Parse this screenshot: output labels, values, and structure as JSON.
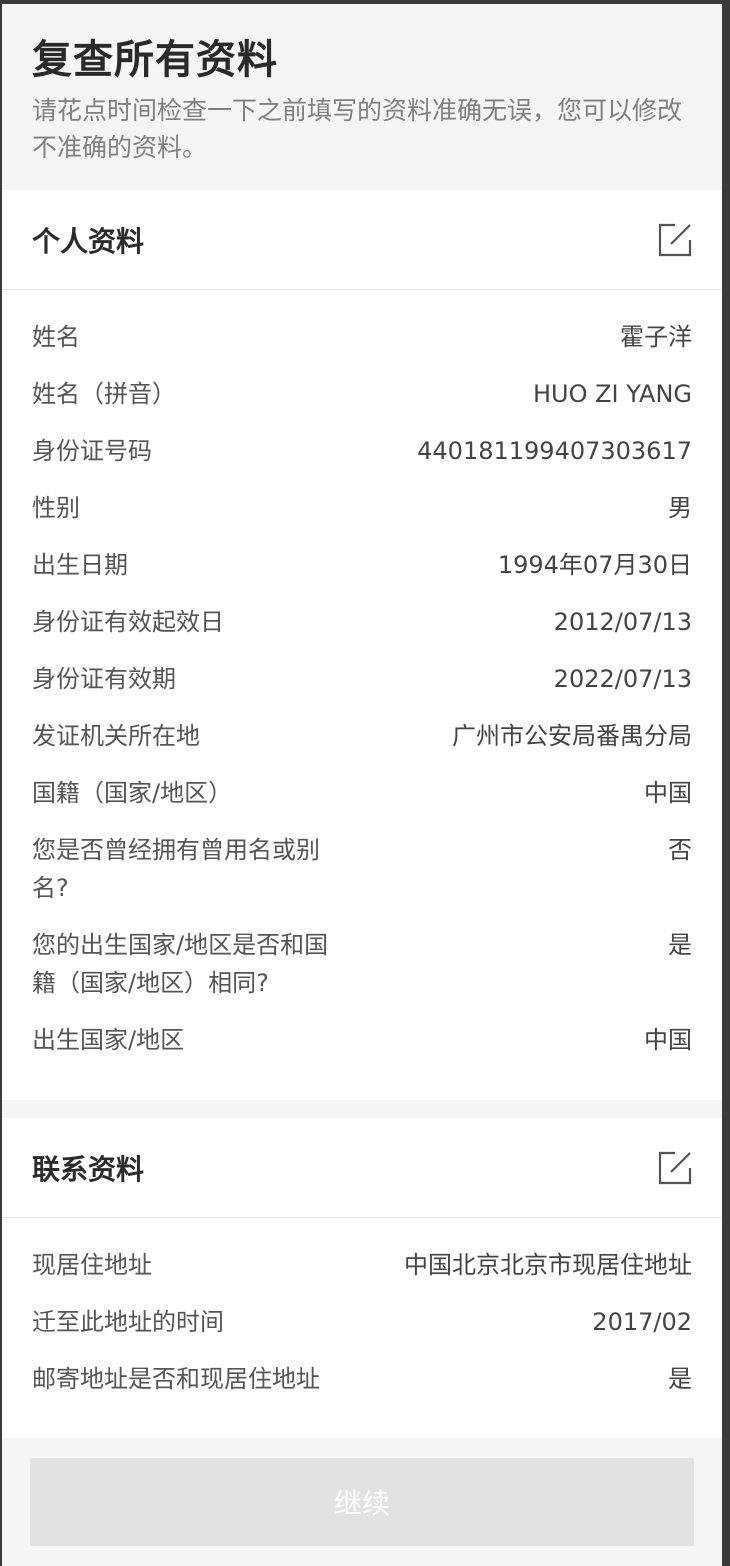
{
  "header": {
    "title": "复查所有资料",
    "subtitle": "请花点时间检查一下之前填写的资料准确无误，您可以修改不准确的资料。"
  },
  "personal": {
    "title": "个人资料",
    "edit_icon": "edit-icon",
    "rows": [
      {
        "label": "姓名",
        "value": "霍子洋"
      },
      {
        "label": "姓名（拼音）",
        "value": "HUO ZI YANG"
      },
      {
        "label": "身份证号码",
        "value": "440181199407303617"
      },
      {
        "label": "性别",
        "value": "男"
      },
      {
        "label": "出生日期",
        "value": "1994年07月30日"
      },
      {
        "label": "身份证有效起效日",
        "value": "2012/07/13"
      },
      {
        "label": "身份证有效期",
        "value": "2022/07/13"
      },
      {
        "label": "发证机关所在地",
        "value": "广州市公安局番禺分局"
      },
      {
        "label": "国籍（国家/地区）",
        "value": "中国"
      },
      {
        "label": "您是否曾经拥有曾用名或别名?",
        "value": "否"
      },
      {
        "label": "您的出生国家/地区是否和国籍（国家/地区）相同?",
        "value": "是"
      },
      {
        "label": "出生国家/地区",
        "value": "中国"
      }
    ]
  },
  "contact": {
    "title": "联系资料",
    "edit_icon": "edit-icon",
    "rows": [
      {
        "label": "现居住地址",
        "value": "中国北京北京市现居住地址"
      },
      {
        "label": "迁至此地址的时间",
        "value": "2017/02"
      },
      {
        "label": "邮寄地址是否和现居住地址",
        "value": "是"
      }
    ]
  },
  "footer": {
    "continue_label": "继续"
  },
  "colors": {
    "background": "#f5f5f5",
    "card": "#ffffff",
    "button_disabled": "#e2e2e2"
  }
}
